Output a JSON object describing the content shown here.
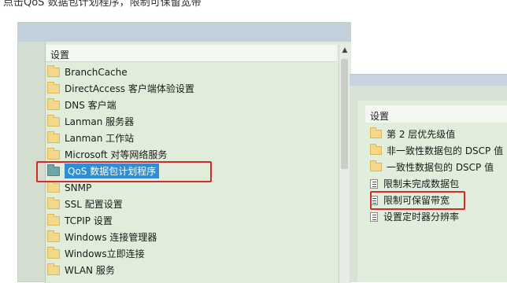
{
  "caption": "点击QoS 数据包计划程序，限制可保留宽带",
  "left_panel": {
    "header": "设置",
    "items": [
      {
        "label": "BranchCache"
      },
      {
        "label": "DirectAccess 客户端体验设置"
      },
      {
        "label": "DNS 客户端"
      },
      {
        "label": "Lanman 服务器"
      },
      {
        "label": "Lanman 工作站"
      },
      {
        "label": "Microsoft 对等网络服务"
      },
      {
        "label": "QoS 数据包计划程序"
      },
      {
        "label": "SNMP"
      },
      {
        "label": "SSL 配置设置"
      },
      {
        "label": "TCPIP 设置"
      },
      {
        "label": "Windows 连接管理器"
      },
      {
        "label": "Windows立即连接"
      },
      {
        "label": "WLAN 服务"
      }
    ]
  },
  "right_panel": {
    "header": "设置",
    "items": [
      {
        "label": "第 2 层优先级值",
        "icon": "folder-icon"
      },
      {
        "label": "非一致性数据包的 DSCP 值",
        "icon": "folder-icon"
      },
      {
        "label": "一致性数据包的 DSCP 值",
        "icon": "folder-icon"
      },
      {
        "label": "限制未完成数据包",
        "icon": "policy-setting-icon"
      },
      {
        "label": "限制可保留带宽",
        "icon": "policy-setting-icon"
      },
      {
        "label": "设置定时器分辨率",
        "icon": "policy-setting-icon"
      }
    ]
  },
  "colors": {
    "highlight": "#d32b2b",
    "selection": "#2f8ed3",
    "panel_bg": "#e0eddb"
  }
}
